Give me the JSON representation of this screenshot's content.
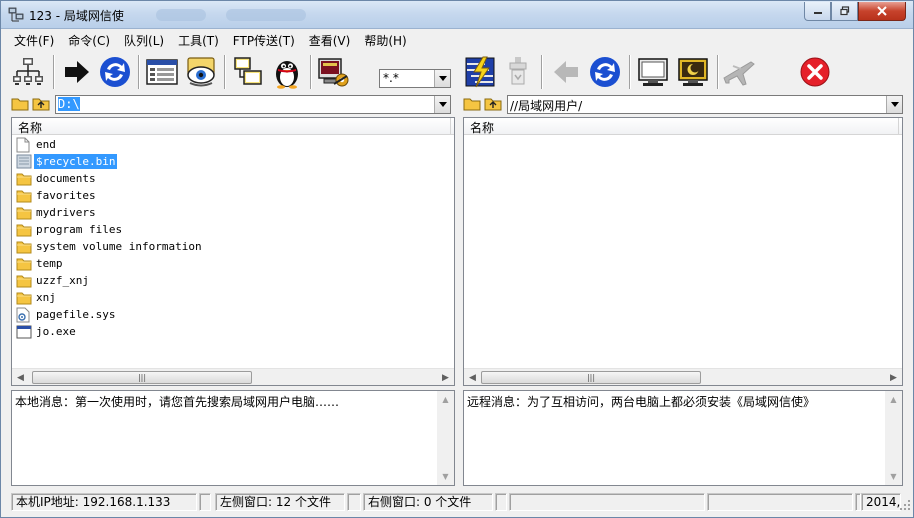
{
  "window": {
    "title": "123 - 局域网信使"
  },
  "menu": [
    "文件(F)",
    "命令(C)",
    "队列(L)",
    "工具(T)",
    "FTP传送(T)",
    "查看(V)",
    "帮助(H)"
  ],
  "toolbar": {
    "filter_value": "*.*"
  },
  "left": {
    "path": "D:\\",
    "column_header": "名称",
    "files": [
      {
        "name": "end",
        "type": "file"
      },
      {
        "name": "$recycle.bin",
        "type": "sysfolder",
        "selected": true
      },
      {
        "name": "documents",
        "type": "folder"
      },
      {
        "name": "favorites",
        "type": "folder"
      },
      {
        "name": "mydrivers",
        "type": "folder"
      },
      {
        "name": "program files",
        "type": "folder"
      },
      {
        "name": "system volume information",
        "type": "folder"
      },
      {
        "name": "temp",
        "type": "folder"
      },
      {
        "name": "uzzf_xnj",
        "type": "folder"
      },
      {
        "name": "xnj",
        "type": "folder"
      },
      {
        "name": "pagefile.sys",
        "type": "sysfile"
      },
      {
        "name": "jo.exe",
        "type": "exe"
      }
    ],
    "message": "本地消息：第一次使用时，请您首先搜索局域网用户电脑……"
  },
  "right": {
    "path": "//局域网用户/",
    "column_header": "名称",
    "message": "远程消息：为了互相访问，两台电脑上都必须安装《局域网信使》"
  },
  "status": {
    "ip": "本机IP地址: 192.168.1.133",
    "left_window": "左侧窗口: 12 个文件",
    "right_window": "右侧窗口: 0 个文件",
    "date": "2014,"
  },
  "colors": {
    "selection": "#3399ff",
    "folder": "#f5c542",
    "title_gradient": "#c6d8ee"
  }
}
